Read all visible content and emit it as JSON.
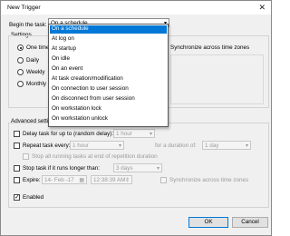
{
  "window": {
    "title": "New Trigger",
    "close_glyph": "✕"
  },
  "begin_task": {
    "label": "Begin the task:",
    "selected": "On a schedule",
    "options": [
      "On a schedule",
      "At log on",
      "At startup",
      "On idle",
      "On an event",
      "At task creation/modification",
      "On connection to user session",
      "On disconnect from user session",
      "On workstation lock",
      "On workstation unlock"
    ]
  },
  "settings": {
    "title": "Settings",
    "radios": [
      {
        "label": "One time",
        "selected": true
      },
      {
        "label": "Daily",
        "selected": false
      },
      {
        "label": "Weekly",
        "selected": false
      },
      {
        "label": "Monthly",
        "selected": false
      }
    ],
    "sync_label": "Synchronize across time zones"
  },
  "advanced": {
    "title": "Advanced settings",
    "delay": {
      "label": "Delay task for up to (random delay):",
      "value": "1 hour",
      "checked": false
    },
    "repeat": {
      "label": "Repeat task every:",
      "value": "1 hour",
      "duration_label": "for a duration of:",
      "duration_value": "1 day",
      "checked": false
    },
    "stop_running": {
      "label": "Stop all running tasks at end of repetition duration",
      "checked": false
    },
    "stop_if": {
      "label": "Stop task if it runs longer than:",
      "value": "3 days",
      "checked": false
    },
    "expire": {
      "label": "Expire:",
      "date": "14- Feb -17",
      "time": "12:38:39 AM",
      "sync_label": "Synchronize across time zones",
      "checked": false
    },
    "enabled": {
      "label": "Enabled",
      "checked": true
    }
  },
  "buttons": {
    "ok": "OK",
    "cancel": "Cancel"
  }
}
